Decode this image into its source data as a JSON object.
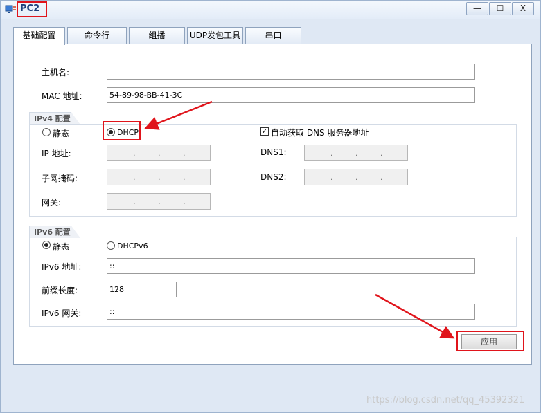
{
  "window": {
    "title": "PC2",
    "minimize": "—",
    "maximize": "☐",
    "close": "X"
  },
  "tabs": [
    {
      "label": "基础配置"
    },
    {
      "label": "命令行"
    },
    {
      "label": "组播"
    },
    {
      "label": "UDP发包工具"
    },
    {
      "label": "串口"
    }
  ],
  "host": {
    "label": "主机名:",
    "value": ""
  },
  "mac": {
    "label": "MAC 地址:",
    "value": "54-89-98-BB-41-3C"
  },
  "ipv4": {
    "group_title": "IPv4 配置",
    "static_label": "静态",
    "dhcp_label": "DHCP",
    "auto_dns_label": "自动获取 DNS 服务器地址",
    "ip_label": "IP 地址:",
    "mask_label": "子网掩码:",
    "gateway_label": "网关:",
    "dns1_label": "DNS1:",
    "dns2_label": "DNS2:",
    "dot": "."
  },
  "ipv6": {
    "group_title": "IPv6 配置",
    "static_label": "静态",
    "dhcp_label": "DHCPv6",
    "addr_label": "IPv6 地址:",
    "addr_value": "::",
    "prefix_label": "前缀长度:",
    "prefix_value": "128",
    "gateway_label": "IPv6 网关:",
    "gateway_value": "::"
  },
  "apply_label": "应用",
  "watermark": "https://blog.csdn.net/qq_45392321",
  "colors": {
    "annotation": "#e0141b",
    "title": "#1e3f7a"
  }
}
